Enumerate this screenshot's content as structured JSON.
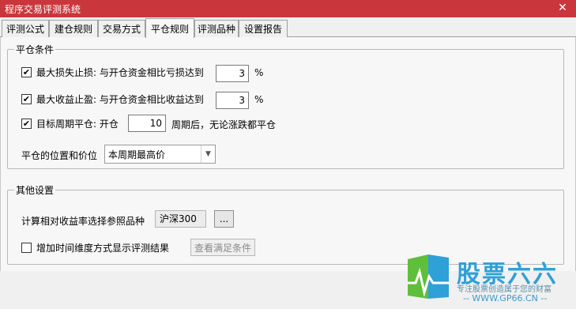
{
  "window": {
    "title": "程序交易评测系统",
    "close_glyph": "✕"
  },
  "tabs": [
    {
      "label": "评测公式",
      "active": false
    },
    {
      "label": "建仓规则",
      "active": false
    },
    {
      "label": "交易方式",
      "active": false
    },
    {
      "label": "平仓规则",
      "active": true
    },
    {
      "label": "评测品种",
      "active": false
    },
    {
      "label": "设置报告",
      "active": false
    }
  ],
  "close_conditions": {
    "title": "平仓条件",
    "stop_loss": {
      "checked": true,
      "label": "最大损失止损: 与开仓资金相比亏损达到",
      "value": "3",
      "unit": "%"
    },
    "take_profit": {
      "checked": true,
      "label": "最大收益止盈: 与开仓资金相比收益达到",
      "value": "3",
      "unit": "%"
    },
    "target_period": {
      "checked": true,
      "label": "目标周期平仓: 开仓",
      "value": "10",
      "suffix": "周期后，无论涨跌都平仓"
    },
    "position_price": {
      "label": "平仓的位置和价位",
      "selected": "本周期最高价"
    }
  },
  "other_settings": {
    "title": "其他设置",
    "reference_label": "计算相对收益率选择参照品种",
    "reference_value": "沪深300",
    "browse_label": "...",
    "time_dimension": {
      "checked": false,
      "label": "增加时间维度方式显示评测结果"
    },
    "view_button_label": "查看满足条件"
  },
  "watermark": {
    "brand": "股票六六",
    "tagline": "专注股票创造属于您的财富",
    "url": "-- WWW.GP66.CN --"
  },
  "colors": {
    "titlebar": "#c9373c",
    "brand_blue": "#2fa0d8",
    "brand_green": "#5fbf3a"
  }
}
